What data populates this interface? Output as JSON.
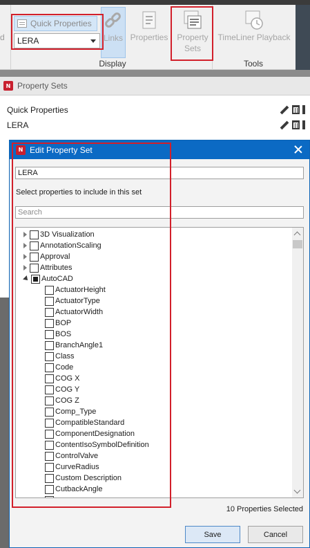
{
  "ribbon": {
    "left_fragment": "d",
    "quick_properties_label": "Quick Properties",
    "property_set_select_value": "LERA",
    "links_label": "Links",
    "properties_label": "Properties",
    "property_sets_label_line1": "Property",
    "property_sets_label_line2": "Sets",
    "timeliner_label": "TimeLiner Playback",
    "group_display": "Display",
    "group_tools": "Tools"
  },
  "panel": {
    "title": "Property Sets",
    "logo_text": "N",
    "sets": [
      {
        "name": "Quick Properties"
      },
      {
        "name": "LERA"
      }
    ]
  },
  "dialog": {
    "title": "Edit Property Set",
    "logo_text": "N",
    "name_value": "LERA",
    "select_label": "Select properties to include in this set",
    "search_placeholder": "Search",
    "categories": [
      {
        "label": "3D Visualization",
        "expanded": false
      },
      {
        "label": "AnnotationScaling",
        "expanded": false
      },
      {
        "label": "Approval",
        "expanded": false
      },
      {
        "label": "Attributes",
        "expanded": false
      },
      {
        "label": "AutoCAD",
        "expanded": true
      }
    ],
    "autocad_properties": [
      "ActuatorHeight",
      "ActuatorType",
      "ActuatorWidth",
      "BOP",
      "BOS",
      "BranchAngle1",
      "Class",
      "Code",
      "COG X",
      "COG Y",
      "COG Z",
      "Comp_Type",
      "CompatibleStandard",
      "ComponentDesignation",
      "ContentIsoSymbolDefinition",
      "ControlValve",
      "CurveRadius",
      "Custom Description",
      "CutbackAngle"
    ],
    "selected_count_label": "10 Properties Selected",
    "save_label": "Save",
    "cancel_label": "Cancel"
  },
  "colors": {
    "title_bar": "#0b6ac4",
    "highlight": "#d21f2a",
    "ribbon_bg": "#f0f0f0",
    "logo": "#c8202f"
  }
}
